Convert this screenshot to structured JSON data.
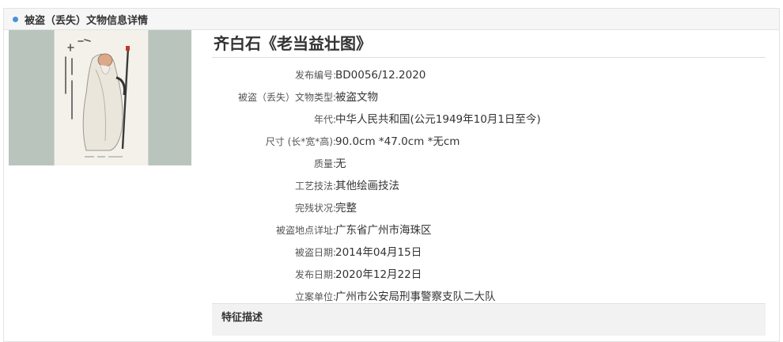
{
  "panel": {
    "title": "被盗（丢失）文物信息详情"
  },
  "artifact": {
    "title": "齐白石《老当益壮图》",
    "fields": [
      {
        "label": "发布编号:",
        "value": "BD0056/12.2020"
      },
      {
        "label": "被盗（丢失）文物类型:",
        "value": "被盗文物"
      },
      {
        "label": "年代:",
        "value": "中华人民共和国(公元1949年10月1日至今)"
      },
      {
        "label": "尺寸 (长*宽*高):",
        "value": "90.0cm *47.0cm *无cm"
      },
      {
        "label": "质量:",
        "value": "无"
      },
      {
        "label": "工艺技法:",
        "value": "其他绘画技法"
      },
      {
        "label": "完残状况:",
        "value": "完整"
      },
      {
        "label": "被盗地点详址:",
        "value": "广东省广州市海珠区"
      },
      {
        "label": "被盗日期:",
        "value": "2014年04月15日"
      },
      {
        "label": "发布日期:",
        "value": "2020年12月22日"
      },
      {
        "label": "立案单位:",
        "value": "广州市公安局刑事警察支队二大队"
      }
    ]
  },
  "section": {
    "title": "特征描述"
  },
  "colors": {
    "accent": "#4a90d9",
    "header_bg": "#f6f6f6",
    "thumb_bg": "#b9c4bd"
  }
}
